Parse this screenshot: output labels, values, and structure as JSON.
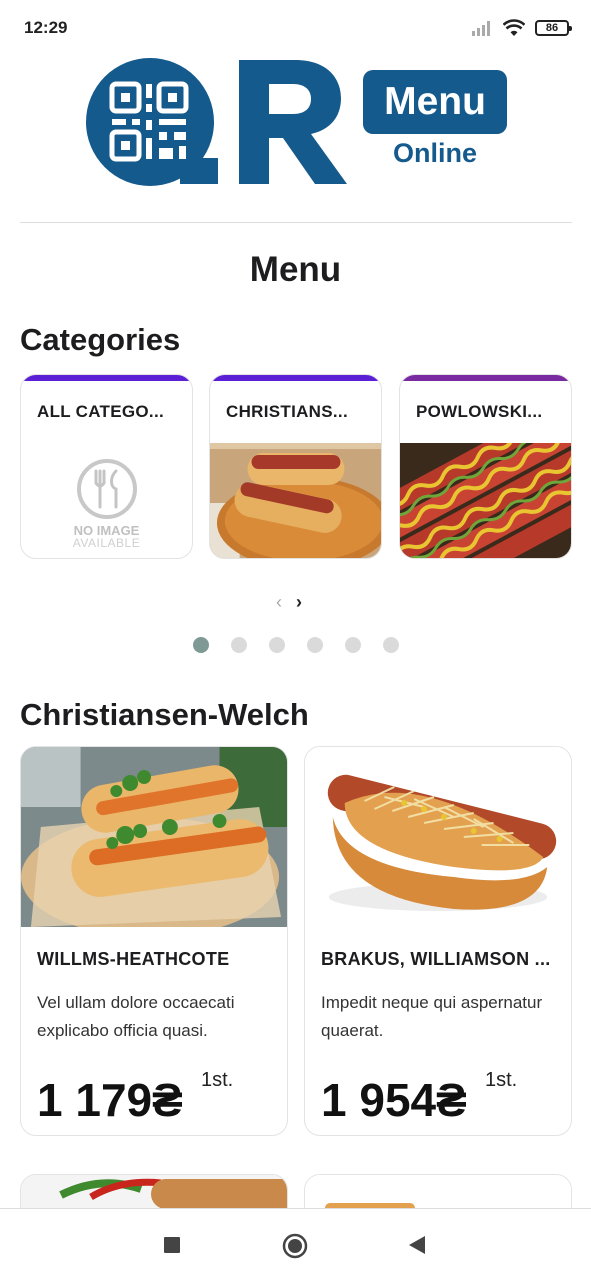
{
  "status_bar": {
    "time": "12:29",
    "battery": "86"
  },
  "logo": {
    "q": "Q",
    "r": "R",
    "menu": "Menu",
    "online": "Online"
  },
  "page_title": "Menu",
  "categories": {
    "title": "Categories",
    "items": [
      {
        "label": "ALL CATEGO...",
        "accent": "#5b1fd6",
        "image": "no-image",
        "no_image_line1": "NO IMAGE",
        "no_image_line2": "AVAILABLE"
      },
      {
        "label": "CHRISTIANS...",
        "accent": "#5b1fd6",
        "image": "hot-dog-bacon"
      },
      {
        "label": "POWLOWSKI...",
        "accent": "#7a2aa0",
        "image": "hot-dogs-mustard"
      }
    ],
    "prev_arrow": "‹",
    "next_arrow": "›",
    "pages": 6,
    "active_page": 1
  },
  "section": {
    "title": "Christiansen-Welch",
    "products": [
      {
        "name": "WILLMS-HEATHCOTE",
        "description": "Vel ullam dolore occaecati explicabo officia quasi.",
        "price": "1 179₴",
        "unit": "1st.",
        "image": "hot-dog-carrot"
      },
      {
        "name": "BRAKUS, WILLIAMSON ...",
        "description": "Impedit neque qui aspernatur quaerat.",
        "price": "1 954₴",
        "unit": "1st.",
        "image": "hot-dog-cheese"
      }
    ]
  },
  "colors": {
    "brand": "#155a8c",
    "accent_purple": "#5b1fd6",
    "dot_active": "#7f9a95"
  }
}
